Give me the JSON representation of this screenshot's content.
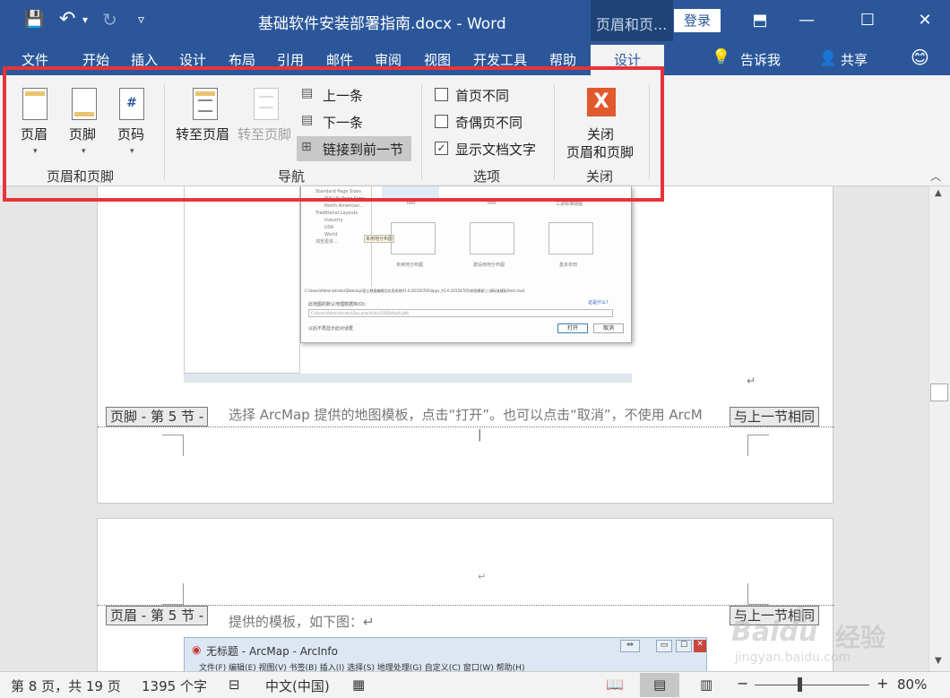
{
  "window": {
    "title": "基础软件安装部署指南.docx - Word",
    "context_tab": "页眉和页...",
    "login": "登录",
    "buttons": {
      "minimize": "—",
      "maximize": "☐",
      "close": "✕",
      "ribbon_display": "⬒"
    }
  },
  "qat": {
    "save": "💾",
    "undo": "↶",
    "undo_dropdown": "▾",
    "redo": "↻",
    "customize": "▿"
  },
  "tabs": [
    "文件",
    "开始",
    "插入",
    "设计",
    "布局",
    "引用",
    "邮件",
    "审阅",
    "视图",
    "开发工具",
    "帮助"
  ],
  "active_tab": "设计",
  "tell_me": "告诉我",
  "share": "共享",
  "emoji": "😊",
  "ribbon": {
    "groups": {
      "hf": "页眉和页脚",
      "nav": "导航",
      "options": "选项",
      "close": "关闭"
    },
    "header_btn": "页眉",
    "footer_btn": "页脚",
    "page_num_btn": "页码",
    "goto_header": "转至页眉",
    "goto_footer": "转至页脚",
    "prev": "上一条",
    "next": "下一条",
    "link_prev": "链接到前一节",
    "opt_first": "首页不同",
    "opt_odd_even": "奇偶页不同",
    "opt_show_text": "显示文档文字",
    "opt_show_text_checked": true,
    "close_line1": "关闭",
    "close_line2": "页眉和页脚",
    "close_x": "X",
    "collapse": "︿"
  },
  "doc": {
    "footer_tag": "页脚 - 第 5 节 -",
    "same_as_prev": "与上一节相同",
    "line1": "选择 ArcMap 提供的地图模板，点击“打开”。也可以点击“取消”，不使用 ArcM",
    "return_mark": "↵",
    "header_tag": "页眉 - 第 5 节 -",
    "line2": "提供的模板，如下图：↵",
    "arcmap_title": "无标题 - ArcMap - ArcInfo",
    "arcmap_menu": "文件(F)   编辑(E)   视图(V)   书签(B)   插入(I)   选择(S)   地理处理(G)   自定义(C)   窗口(W)   帮助(H)",
    "dialog_path": "C:\\Users\\Administrator\\Desktop\\国土数据编辑及应用系统V1.0.20150705\\Apps_V1.0.20150705\\底图模板\\三调标准模板\\test.mxd",
    "dialog_open": "打开",
    "dialog_cancel": "取消",
    "dialog_checkbox": "以后不再显示此对话框",
    "dialog_default_label": "此地图的默认地理数据库(D):",
    "dialog_default_path": "C:\\Users\\Administrator\\Documents\\ArcGIS\\Default.gdb",
    "dialog_tree": [
      "Standard Page Sizes",
      "ISO (A) Page Sizes",
      "North American...",
      "Traditional Layouts",
      "Industry",
      "USA",
      "World",
      "浏览更多..."
    ],
    "dialog_thumbs": [
      "未用地分布图",
      "建设用地分布图",
      "基本农田"
    ],
    "dialog_thumbs_top": [
      "test",
      "test",
      "三调标准底图"
    ],
    "dialog_link": "这是什么?",
    "dialog_tooltip": "未用地分布图"
  },
  "status": {
    "page": "第 8 页，共 19 页",
    "words": "1395 个字",
    "lang": "中文(中国)",
    "zoom": "80%",
    "zoom_level": 0.8
  },
  "watermark": {
    "brand": "Baidu",
    "brand_cn": "经验",
    "url": "jingyan.baidu.com"
  },
  "colors": {
    "word_blue": "#2b579a",
    "frame_red": "#e8333a",
    "close_orange": "#e0592f"
  }
}
